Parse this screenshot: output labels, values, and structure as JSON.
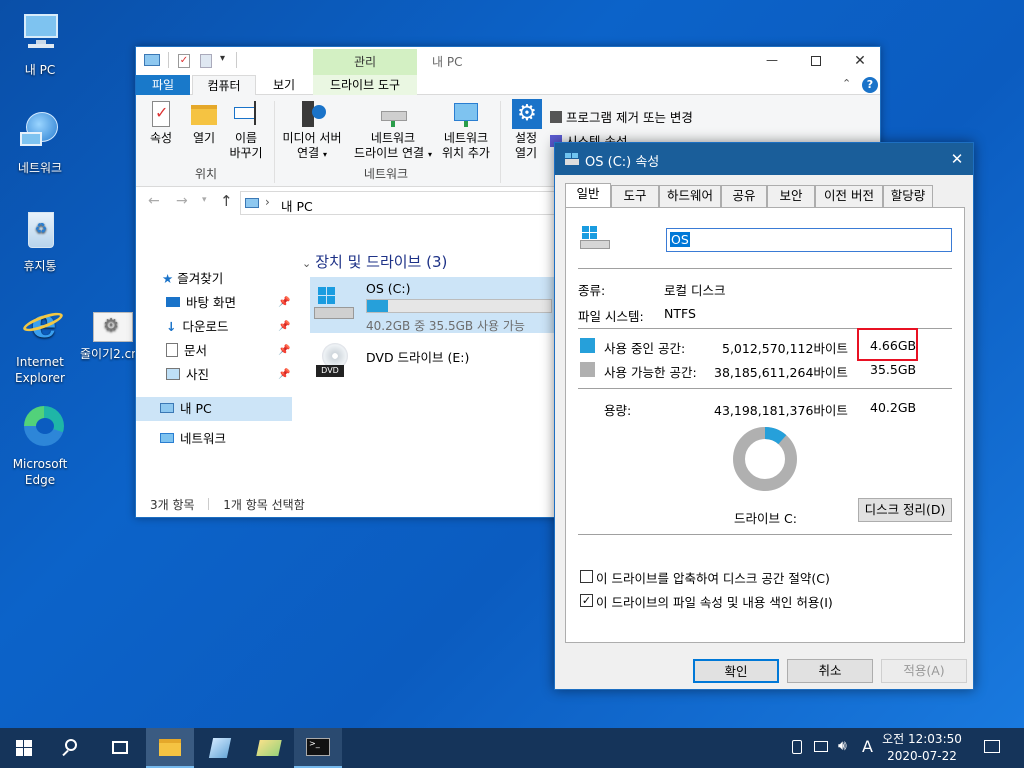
{
  "desktop": {
    "icons": [
      {
        "label": "내 PC"
      },
      {
        "label": "네트워크"
      },
      {
        "label": "휴지통"
      },
      {
        "label": "Internet Explorer"
      },
      {
        "label": "Microsoft Edge"
      },
      {
        "label": "줄이기2.cmd"
      }
    ]
  },
  "explorer": {
    "title": "내 PC",
    "context_tab": "관리",
    "tabs": [
      "파일",
      "컴퓨터",
      "보기",
      "드라이브 도구"
    ],
    "ribbon": {
      "location_group": "위치",
      "network_group": "네트워크",
      "buttons": {
        "properties": "속성",
        "open": "열기",
        "rename_1": "이름",
        "rename_2": "바꾸기",
        "media_1": "미디어 서버",
        "media_2": "연결",
        "mapdrive_1": "네트워크",
        "mapdrive_2": "드라이브 연결",
        "addloc_1": "네트워크",
        "addloc_2": "위치 추가",
        "settings_1": "설정",
        "settings_2": "열기",
        "uninstall": "프로그램 제거 또는 변경",
        "sysprops": "시스템 속성"
      }
    },
    "address": "내 PC",
    "nav": {
      "quick_access": "즐겨찾기",
      "desktop": "바탕 화면",
      "downloads": "다운로드",
      "documents": "문서",
      "pictures": "사진",
      "this_pc": "내 PC",
      "network": "네트워크"
    },
    "section_header": "장치 및 드라이브 (3)",
    "drives": [
      {
        "name": "OS (C:)",
        "detail": "40.2GB 중 35.5GB 사용 가능",
        "used_fraction": 0.116
      },
      {
        "name": "DVD 드라이브 (E:)",
        "badge": "DVD"
      }
    ],
    "status": {
      "items": "3개 항목",
      "selected": "1개 항목 선택함"
    }
  },
  "dialog": {
    "title": "OS (C:) 속성",
    "tabs": [
      "일반",
      "도구",
      "하드웨어",
      "공유",
      "보안",
      "이전 버전",
      "할당량"
    ],
    "name_value": "OS",
    "type_label": "종류:",
    "type_value": "로컬 디스크",
    "fs_label": "파일 시스템:",
    "fs_value": "NTFS",
    "used_label": "사용 중인 공간:",
    "used_bytes": "5,012,570,112바이트",
    "used_gb": "4.66GB",
    "free_label": "사용 가능한 공간:",
    "free_bytes": "38,185,611,264바이트",
    "free_gb": "35.5GB",
    "capacity_label": "용량:",
    "capacity_bytes": "43,198,181,376바이트",
    "capacity_gb": "40.2GB",
    "drive_label": "드라이브 C:",
    "cleanup_button": "디스크 정리(D)",
    "compress_label": "이 드라이브를 압축하여 디스크 공간 절약(C)",
    "index_label": "이 드라이브의 파일 속성 및 내용 색인 허용(I)",
    "compress_checked": false,
    "index_checked": true,
    "ok": "확인",
    "cancel": "취소",
    "apply": "적용(A)",
    "used_fraction": 0.116,
    "colors": {
      "used": "#26a0da",
      "free": "#b0b0b0",
      "highlight": "#e81123"
    }
  },
  "taskbar": {
    "time": "오전 12:03:50",
    "date": "2020-07-22",
    "ime": "A"
  }
}
